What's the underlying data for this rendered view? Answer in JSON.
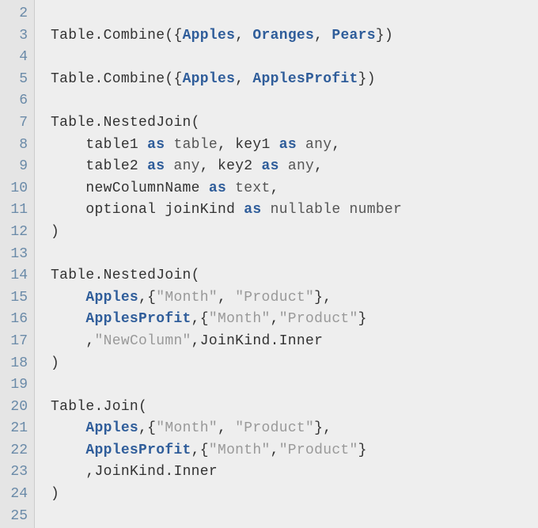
{
  "line_numbers": [
    "2",
    "3",
    "4",
    "5",
    "6",
    "7",
    "8",
    "9",
    "10",
    "11",
    "12",
    "13",
    "14",
    "15",
    "16",
    "17",
    "18",
    "19",
    "20",
    "21",
    "22",
    "23",
    "24",
    "25"
  ],
  "code_lines": [
    {
      "tokens": []
    },
    {
      "tokens": [
        {
          "t": "Table",
          "c": "t-default"
        },
        {
          "t": ".",
          "c": "t-punc"
        },
        {
          "t": "Combine",
          "c": "t-default"
        },
        {
          "t": "({",
          "c": "t-punc"
        },
        {
          "t": "Apples",
          "c": "t-ident"
        },
        {
          "t": ", ",
          "c": "t-punc"
        },
        {
          "t": "Oranges",
          "c": "t-ident"
        },
        {
          "t": ", ",
          "c": "t-punc"
        },
        {
          "t": "Pears",
          "c": "t-ident"
        },
        {
          "t": "})",
          "c": "t-punc"
        }
      ]
    },
    {
      "tokens": []
    },
    {
      "tokens": [
        {
          "t": "Table",
          "c": "t-default"
        },
        {
          "t": ".",
          "c": "t-punc"
        },
        {
          "t": "Combine",
          "c": "t-default"
        },
        {
          "t": "({",
          "c": "t-punc"
        },
        {
          "t": "Apples",
          "c": "t-ident"
        },
        {
          "t": ", ",
          "c": "t-punc"
        },
        {
          "t": "ApplesProfit",
          "c": "t-ident"
        },
        {
          "t": "})",
          "c": "t-punc"
        }
      ]
    },
    {
      "tokens": []
    },
    {
      "tokens": [
        {
          "t": "Table",
          "c": "t-default"
        },
        {
          "t": ".",
          "c": "t-punc"
        },
        {
          "t": "NestedJoin",
          "c": "t-default"
        },
        {
          "t": "(",
          "c": "t-punc"
        }
      ]
    },
    {
      "tokens": [
        {
          "t": "    ",
          "c": "t-default"
        },
        {
          "t": "table1 ",
          "c": "t-default"
        },
        {
          "t": "as",
          "c": "t-kw"
        },
        {
          "t": " table",
          "c": "t-type"
        },
        {
          "t": ", ",
          "c": "t-punc"
        },
        {
          "t": "key1 ",
          "c": "t-default"
        },
        {
          "t": "as",
          "c": "t-kw"
        },
        {
          "t": " any",
          "c": "t-type"
        },
        {
          "t": ",",
          "c": "t-punc"
        }
      ]
    },
    {
      "tokens": [
        {
          "t": "    ",
          "c": "t-default"
        },
        {
          "t": "table2 ",
          "c": "t-default"
        },
        {
          "t": "as",
          "c": "t-kw"
        },
        {
          "t": " any",
          "c": "t-type"
        },
        {
          "t": ", ",
          "c": "t-punc"
        },
        {
          "t": "key2 ",
          "c": "t-default"
        },
        {
          "t": "as",
          "c": "t-kw"
        },
        {
          "t": " any",
          "c": "t-type"
        },
        {
          "t": ",",
          "c": "t-punc"
        }
      ]
    },
    {
      "tokens": [
        {
          "t": "    ",
          "c": "t-default"
        },
        {
          "t": "newColumnName ",
          "c": "t-default"
        },
        {
          "t": "as",
          "c": "t-kw"
        },
        {
          "t": " text",
          "c": "t-type"
        },
        {
          "t": ",",
          "c": "t-punc"
        }
      ]
    },
    {
      "tokens": [
        {
          "t": "    ",
          "c": "t-default"
        },
        {
          "t": "optional",
          "c": "t-default"
        },
        {
          "t": " joinKind ",
          "c": "t-default"
        },
        {
          "t": "as",
          "c": "t-kw"
        },
        {
          "t": " nullable number",
          "c": "t-type"
        }
      ]
    },
    {
      "tokens": [
        {
          "t": ")",
          "c": "t-punc"
        }
      ]
    },
    {
      "tokens": []
    },
    {
      "tokens": [
        {
          "t": "Table",
          "c": "t-default"
        },
        {
          "t": ".",
          "c": "t-punc"
        },
        {
          "t": "NestedJoin",
          "c": "t-default"
        },
        {
          "t": "(",
          "c": "t-punc"
        }
      ]
    },
    {
      "tokens": [
        {
          "t": "    ",
          "c": "t-default"
        },
        {
          "t": "Apples",
          "c": "t-ident"
        },
        {
          "t": ",{",
          "c": "t-punc"
        },
        {
          "t": "\"Month\"",
          "c": "t-str"
        },
        {
          "t": ", ",
          "c": "t-punc"
        },
        {
          "t": "\"Product\"",
          "c": "t-str"
        },
        {
          "t": "},",
          "c": "t-punc"
        }
      ]
    },
    {
      "tokens": [
        {
          "t": "    ",
          "c": "t-default"
        },
        {
          "t": "ApplesProfit",
          "c": "t-ident"
        },
        {
          "t": ",{",
          "c": "t-punc"
        },
        {
          "t": "\"Month\"",
          "c": "t-str"
        },
        {
          "t": ",",
          "c": "t-punc"
        },
        {
          "t": "\"Product\"",
          "c": "t-str"
        },
        {
          "t": "}",
          "c": "t-punc"
        }
      ]
    },
    {
      "tokens": [
        {
          "t": "    ",
          "c": "t-default"
        },
        {
          "t": ",",
          "c": "t-punc"
        },
        {
          "t": "\"NewColumn\"",
          "c": "t-str"
        },
        {
          "t": ",",
          "c": "t-punc"
        },
        {
          "t": "JoinKind",
          "c": "t-default"
        },
        {
          "t": ".",
          "c": "t-punc"
        },
        {
          "t": "Inner",
          "c": "t-default"
        }
      ]
    },
    {
      "tokens": [
        {
          "t": ")",
          "c": "t-punc"
        }
      ]
    },
    {
      "tokens": []
    },
    {
      "tokens": [
        {
          "t": "Table",
          "c": "t-default"
        },
        {
          "t": ".",
          "c": "t-punc"
        },
        {
          "t": "Join",
          "c": "t-default"
        },
        {
          "t": "(",
          "c": "t-punc"
        }
      ]
    },
    {
      "tokens": [
        {
          "t": "    ",
          "c": "t-default"
        },
        {
          "t": "Apples",
          "c": "t-ident"
        },
        {
          "t": ",{",
          "c": "t-punc"
        },
        {
          "t": "\"Month\"",
          "c": "t-str"
        },
        {
          "t": ", ",
          "c": "t-punc"
        },
        {
          "t": "\"Product\"",
          "c": "t-str"
        },
        {
          "t": "},",
          "c": "t-punc"
        }
      ]
    },
    {
      "tokens": [
        {
          "t": "    ",
          "c": "t-default"
        },
        {
          "t": "ApplesProfit",
          "c": "t-ident"
        },
        {
          "t": ",{",
          "c": "t-punc"
        },
        {
          "t": "\"Month\"",
          "c": "t-str"
        },
        {
          "t": ",",
          "c": "t-punc"
        },
        {
          "t": "\"Product\"",
          "c": "t-str"
        },
        {
          "t": "}",
          "c": "t-punc"
        }
      ]
    },
    {
      "tokens": [
        {
          "t": "    ",
          "c": "t-default"
        },
        {
          "t": ",",
          "c": "t-punc"
        },
        {
          "t": "JoinKind",
          "c": "t-default"
        },
        {
          "t": ".",
          "c": "t-punc"
        },
        {
          "t": "Inner",
          "c": "t-default"
        }
      ]
    },
    {
      "tokens": [
        {
          "t": ")",
          "c": "t-punc"
        }
      ]
    },
    {
      "tokens": []
    }
  ]
}
